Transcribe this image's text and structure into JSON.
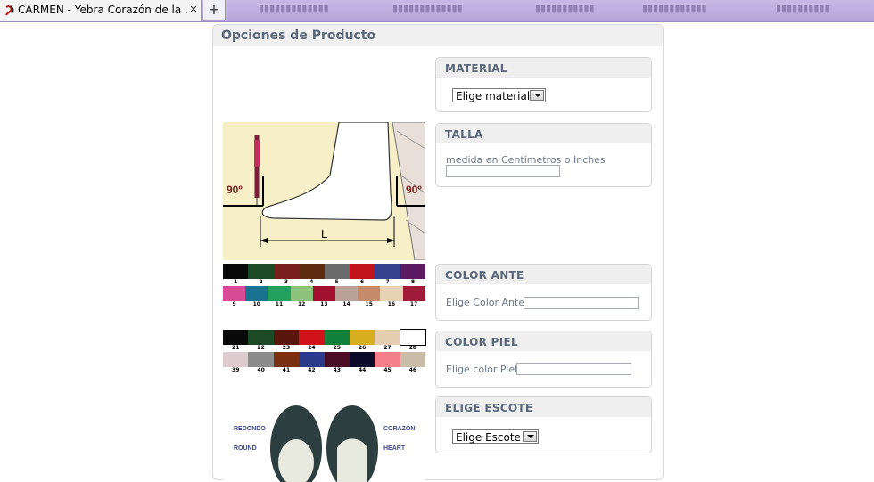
{
  "browser": {
    "tab_title": "CARMEN - Yebra Corazón de la ...",
    "close_glyph": "×",
    "new_tab_glyph": "+"
  },
  "panel": {
    "title": "Opciones de Producto"
  },
  "options": {
    "material": {
      "header": "MATERIAL",
      "select_value": "Elige material"
    },
    "talla": {
      "header": "TALLA",
      "label": "medida en Centímetros o Inches"
    },
    "color_ante": {
      "header": "COLOR ANTE",
      "label": "Elige Color Ante"
    },
    "color_piel": {
      "header": "COLOR PIEL",
      "label": "Elige color Piel"
    },
    "escote": {
      "header": "ELIGE ESCOTE",
      "select_value": "Elige Escote"
    }
  },
  "foot_diagram": {
    "left_angle": "90º",
    "right_angle": "90º",
    "length_label": "L"
  },
  "ante_palette": {
    "row1": [
      {
        "n": "1",
        "c": "#0a0a0a"
      },
      {
        "n": "2",
        "c": "#1c4a25"
      },
      {
        "n": "3",
        "c": "#7a1d1d"
      },
      {
        "n": "4",
        "c": "#5e2a10"
      },
      {
        "n": "5",
        "c": "#6b6b6b"
      },
      {
        "n": "6",
        "c": "#c0141b"
      },
      {
        "n": "7",
        "c": "#34428f"
      },
      {
        "n": "8",
        "c": "#5b1a62"
      }
    ],
    "row2": [
      {
        "n": "9",
        "c": "#d84a95"
      },
      {
        "n": "10",
        "c": "#17738f"
      },
      {
        "n": "11",
        "c": "#22a05c"
      },
      {
        "n": "12",
        "c": "#8cc27a"
      },
      {
        "n": "13",
        "c": "#a1102e"
      },
      {
        "n": "14",
        "c": "#b9a19a"
      },
      {
        "n": "15",
        "c": "#c48c6a"
      },
      {
        "n": "16",
        "c": "#e6d1b2"
      },
      {
        "n": "17",
        "c": "#a01a3a"
      }
    ]
  },
  "piel_palette": {
    "row1": [
      {
        "n": "21",
        "c": "#0a0a0a"
      },
      {
        "n": "22",
        "c": "#1c4a25"
      },
      {
        "n": "23",
        "c": "#5a150c"
      },
      {
        "n": "24",
        "c": "#d0131b"
      },
      {
        "n": "25",
        "c": "#11803a"
      },
      {
        "n": "26",
        "c": "#d6b021"
      },
      {
        "n": "27",
        "c": "#e6cfb0"
      },
      {
        "n": "28",
        "c": "#ffffff"
      }
    ],
    "row2": [
      {
        "n": "39",
        "c": "#ddcbd0"
      },
      {
        "n": "40",
        "c": "#8c8c8c"
      },
      {
        "n": "41",
        "c": "#7a3010"
      },
      {
        "n": "42",
        "c": "#2c3a8a"
      },
      {
        "n": "43",
        "c": "#4a0f24"
      },
      {
        "n": "44",
        "c": "#0c0c2a"
      },
      {
        "n": "45",
        "c": "#f27f8a"
      },
      {
        "n": "46",
        "c": "#c9bda7"
      }
    ]
  },
  "shoe_image": {
    "left_top": "REDONDO",
    "left_bottom": "ROUND",
    "right_top": "CORAZÓN",
    "right_bottom": "HEART"
  },
  "colors": {
    "accent_text": "#59677a",
    "tab_strip": "#b7a3d9"
  }
}
